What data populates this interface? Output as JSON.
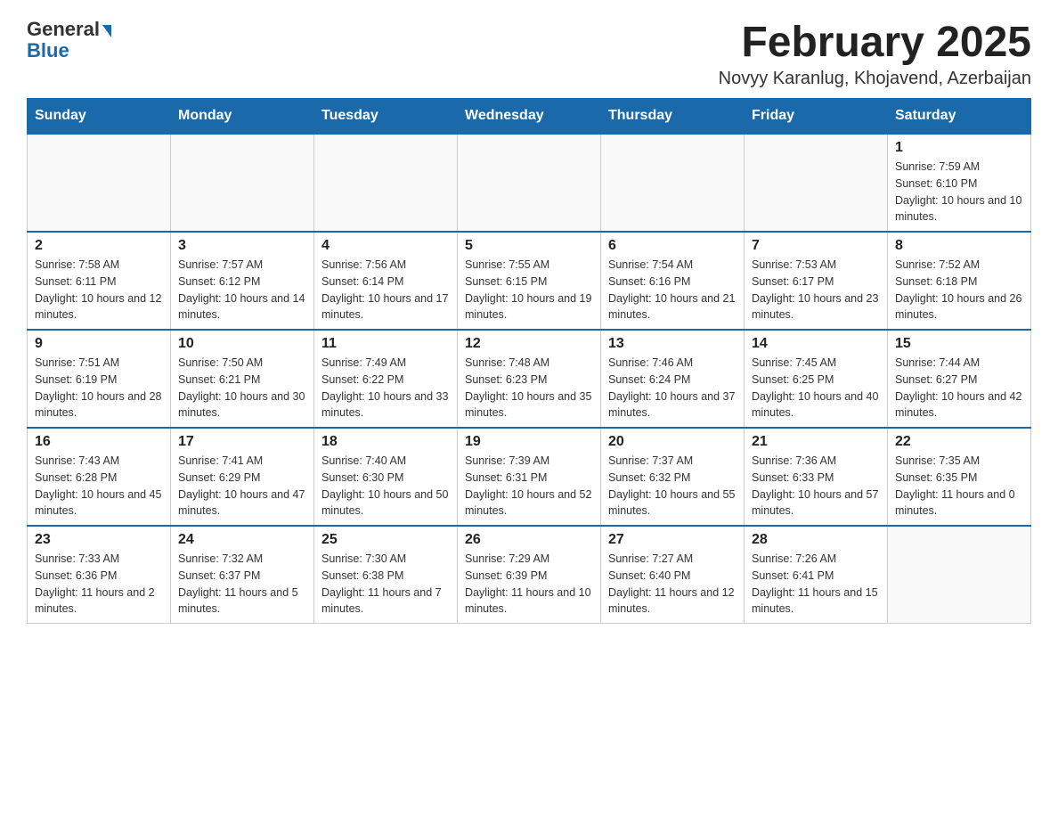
{
  "header": {
    "logo_general": "General",
    "logo_blue": "Blue",
    "title": "February 2025",
    "location": "Novyy Karanlug, Khojavend, Azerbaijan"
  },
  "days_of_week": [
    "Sunday",
    "Monday",
    "Tuesday",
    "Wednesday",
    "Thursday",
    "Friday",
    "Saturday"
  ],
  "weeks": [
    [
      {
        "day": "",
        "info": ""
      },
      {
        "day": "",
        "info": ""
      },
      {
        "day": "",
        "info": ""
      },
      {
        "day": "",
        "info": ""
      },
      {
        "day": "",
        "info": ""
      },
      {
        "day": "",
        "info": ""
      },
      {
        "day": "1",
        "info": "Sunrise: 7:59 AM\nSunset: 6:10 PM\nDaylight: 10 hours and 10 minutes."
      }
    ],
    [
      {
        "day": "2",
        "info": "Sunrise: 7:58 AM\nSunset: 6:11 PM\nDaylight: 10 hours and 12 minutes."
      },
      {
        "day": "3",
        "info": "Sunrise: 7:57 AM\nSunset: 6:12 PM\nDaylight: 10 hours and 14 minutes."
      },
      {
        "day": "4",
        "info": "Sunrise: 7:56 AM\nSunset: 6:14 PM\nDaylight: 10 hours and 17 minutes."
      },
      {
        "day": "5",
        "info": "Sunrise: 7:55 AM\nSunset: 6:15 PM\nDaylight: 10 hours and 19 minutes."
      },
      {
        "day": "6",
        "info": "Sunrise: 7:54 AM\nSunset: 6:16 PM\nDaylight: 10 hours and 21 minutes."
      },
      {
        "day": "7",
        "info": "Sunrise: 7:53 AM\nSunset: 6:17 PM\nDaylight: 10 hours and 23 minutes."
      },
      {
        "day": "8",
        "info": "Sunrise: 7:52 AM\nSunset: 6:18 PM\nDaylight: 10 hours and 26 minutes."
      }
    ],
    [
      {
        "day": "9",
        "info": "Sunrise: 7:51 AM\nSunset: 6:19 PM\nDaylight: 10 hours and 28 minutes."
      },
      {
        "day": "10",
        "info": "Sunrise: 7:50 AM\nSunset: 6:21 PM\nDaylight: 10 hours and 30 minutes."
      },
      {
        "day": "11",
        "info": "Sunrise: 7:49 AM\nSunset: 6:22 PM\nDaylight: 10 hours and 33 minutes."
      },
      {
        "day": "12",
        "info": "Sunrise: 7:48 AM\nSunset: 6:23 PM\nDaylight: 10 hours and 35 minutes."
      },
      {
        "day": "13",
        "info": "Sunrise: 7:46 AM\nSunset: 6:24 PM\nDaylight: 10 hours and 37 minutes."
      },
      {
        "day": "14",
        "info": "Sunrise: 7:45 AM\nSunset: 6:25 PM\nDaylight: 10 hours and 40 minutes."
      },
      {
        "day": "15",
        "info": "Sunrise: 7:44 AM\nSunset: 6:27 PM\nDaylight: 10 hours and 42 minutes."
      }
    ],
    [
      {
        "day": "16",
        "info": "Sunrise: 7:43 AM\nSunset: 6:28 PM\nDaylight: 10 hours and 45 minutes."
      },
      {
        "day": "17",
        "info": "Sunrise: 7:41 AM\nSunset: 6:29 PM\nDaylight: 10 hours and 47 minutes."
      },
      {
        "day": "18",
        "info": "Sunrise: 7:40 AM\nSunset: 6:30 PM\nDaylight: 10 hours and 50 minutes."
      },
      {
        "day": "19",
        "info": "Sunrise: 7:39 AM\nSunset: 6:31 PM\nDaylight: 10 hours and 52 minutes."
      },
      {
        "day": "20",
        "info": "Sunrise: 7:37 AM\nSunset: 6:32 PM\nDaylight: 10 hours and 55 minutes."
      },
      {
        "day": "21",
        "info": "Sunrise: 7:36 AM\nSunset: 6:33 PM\nDaylight: 10 hours and 57 minutes."
      },
      {
        "day": "22",
        "info": "Sunrise: 7:35 AM\nSunset: 6:35 PM\nDaylight: 11 hours and 0 minutes."
      }
    ],
    [
      {
        "day": "23",
        "info": "Sunrise: 7:33 AM\nSunset: 6:36 PM\nDaylight: 11 hours and 2 minutes."
      },
      {
        "day": "24",
        "info": "Sunrise: 7:32 AM\nSunset: 6:37 PM\nDaylight: 11 hours and 5 minutes."
      },
      {
        "day": "25",
        "info": "Sunrise: 7:30 AM\nSunset: 6:38 PM\nDaylight: 11 hours and 7 minutes."
      },
      {
        "day": "26",
        "info": "Sunrise: 7:29 AM\nSunset: 6:39 PM\nDaylight: 11 hours and 10 minutes."
      },
      {
        "day": "27",
        "info": "Sunrise: 7:27 AM\nSunset: 6:40 PM\nDaylight: 11 hours and 12 minutes."
      },
      {
        "day": "28",
        "info": "Sunrise: 7:26 AM\nSunset: 6:41 PM\nDaylight: 11 hours and 15 minutes."
      },
      {
        "day": "",
        "info": ""
      }
    ]
  ]
}
